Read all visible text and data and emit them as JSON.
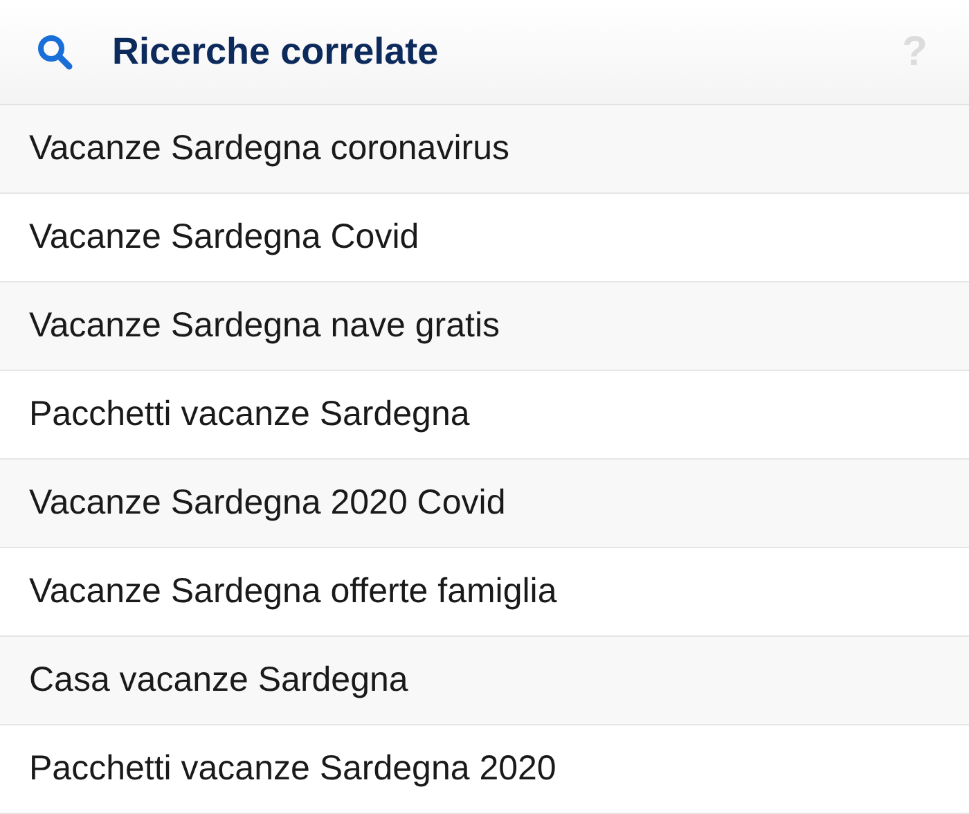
{
  "header": {
    "title": "Ricerche correlate",
    "help": "?"
  },
  "items": [
    {
      "label": "Vacanze Sardegna coronavirus"
    },
    {
      "label": "Vacanze Sardegna Covid"
    },
    {
      "label": "Vacanze Sardegna nave gratis"
    },
    {
      "label": "Pacchetti vacanze Sardegna"
    },
    {
      "label": "Vacanze Sardegna 2020 Covid"
    },
    {
      "label": "Vacanze Sardegna offerte famiglia"
    },
    {
      "label": "Casa vacanze Sardegna"
    },
    {
      "label": "Pacchetti vacanze Sardegna 2020"
    }
  ]
}
